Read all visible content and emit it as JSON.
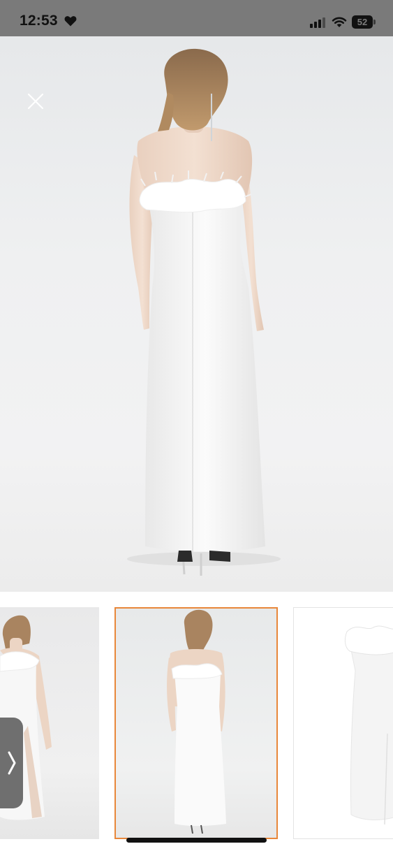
{
  "status_bar": {
    "time": "12:53",
    "battery_level": "52",
    "icons": [
      "heart-icon",
      "cellular-signal-icon",
      "wifi-icon",
      "battery-icon"
    ]
  },
  "viewer": {
    "close_icon": "close-icon",
    "next_icon": "chevron-right-icon",
    "selected_thumbnail": 2,
    "accent_color": "#e8873a"
  },
  "thumbnails": [
    {
      "index": 1,
      "view": "front-model"
    },
    {
      "index": 2,
      "view": "back-model"
    },
    {
      "index": 3,
      "view": "product-flat"
    }
  ]
}
